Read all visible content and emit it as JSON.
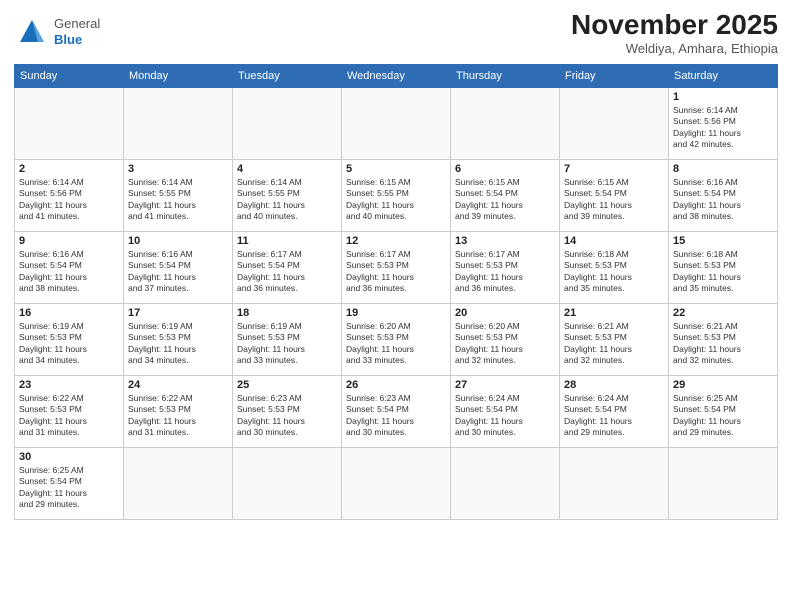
{
  "header": {
    "logo": {
      "general": "General",
      "blue": "Blue"
    },
    "month": "November 2025",
    "location": "Weldiya, Amhara, Ethiopia"
  },
  "weekdays": [
    "Sunday",
    "Monday",
    "Tuesday",
    "Wednesday",
    "Thursday",
    "Friday",
    "Saturday"
  ],
  "weeks": [
    [
      {
        "day": "",
        "info": ""
      },
      {
        "day": "",
        "info": ""
      },
      {
        "day": "",
        "info": ""
      },
      {
        "day": "",
        "info": ""
      },
      {
        "day": "",
        "info": ""
      },
      {
        "day": "",
        "info": ""
      },
      {
        "day": "1",
        "info": "Sunrise: 6:14 AM\nSunset: 5:56 PM\nDaylight: 11 hours\nand 42 minutes."
      }
    ],
    [
      {
        "day": "2",
        "info": "Sunrise: 6:14 AM\nSunset: 5:56 PM\nDaylight: 11 hours\nand 41 minutes."
      },
      {
        "day": "3",
        "info": "Sunrise: 6:14 AM\nSunset: 5:55 PM\nDaylight: 11 hours\nand 41 minutes."
      },
      {
        "day": "4",
        "info": "Sunrise: 6:14 AM\nSunset: 5:55 PM\nDaylight: 11 hours\nand 40 minutes."
      },
      {
        "day": "5",
        "info": "Sunrise: 6:15 AM\nSunset: 5:55 PM\nDaylight: 11 hours\nand 40 minutes."
      },
      {
        "day": "6",
        "info": "Sunrise: 6:15 AM\nSunset: 5:54 PM\nDaylight: 11 hours\nand 39 minutes."
      },
      {
        "day": "7",
        "info": "Sunrise: 6:15 AM\nSunset: 5:54 PM\nDaylight: 11 hours\nand 39 minutes."
      },
      {
        "day": "8",
        "info": "Sunrise: 6:16 AM\nSunset: 5:54 PM\nDaylight: 11 hours\nand 38 minutes."
      }
    ],
    [
      {
        "day": "9",
        "info": "Sunrise: 6:16 AM\nSunset: 5:54 PM\nDaylight: 11 hours\nand 38 minutes."
      },
      {
        "day": "10",
        "info": "Sunrise: 6:16 AM\nSunset: 5:54 PM\nDaylight: 11 hours\nand 37 minutes."
      },
      {
        "day": "11",
        "info": "Sunrise: 6:17 AM\nSunset: 5:54 PM\nDaylight: 11 hours\nand 36 minutes."
      },
      {
        "day": "12",
        "info": "Sunrise: 6:17 AM\nSunset: 5:53 PM\nDaylight: 11 hours\nand 36 minutes."
      },
      {
        "day": "13",
        "info": "Sunrise: 6:17 AM\nSunset: 5:53 PM\nDaylight: 11 hours\nand 36 minutes."
      },
      {
        "day": "14",
        "info": "Sunrise: 6:18 AM\nSunset: 5:53 PM\nDaylight: 11 hours\nand 35 minutes."
      },
      {
        "day": "15",
        "info": "Sunrise: 6:18 AM\nSunset: 5:53 PM\nDaylight: 11 hours\nand 35 minutes."
      }
    ],
    [
      {
        "day": "16",
        "info": "Sunrise: 6:19 AM\nSunset: 5:53 PM\nDaylight: 11 hours\nand 34 minutes."
      },
      {
        "day": "17",
        "info": "Sunrise: 6:19 AM\nSunset: 5:53 PM\nDaylight: 11 hours\nand 34 minutes."
      },
      {
        "day": "18",
        "info": "Sunrise: 6:19 AM\nSunset: 5:53 PM\nDaylight: 11 hours\nand 33 minutes."
      },
      {
        "day": "19",
        "info": "Sunrise: 6:20 AM\nSunset: 5:53 PM\nDaylight: 11 hours\nand 33 minutes."
      },
      {
        "day": "20",
        "info": "Sunrise: 6:20 AM\nSunset: 5:53 PM\nDaylight: 11 hours\nand 32 minutes."
      },
      {
        "day": "21",
        "info": "Sunrise: 6:21 AM\nSunset: 5:53 PM\nDaylight: 11 hours\nand 32 minutes."
      },
      {
        "day": "22",
        "info": "Sunrise: 6:21 AM\nSunset: 5:53 PM\nDaylight: 11 hours\nand 32 minutes."
      }
    ],
    [
      {
        "day": "23",
        "info": "Sunrise: 6:22 AM\nSunset: 5:53 PM\nDaylight: 11 hours\nand 31 minutes."
      },
      {
        "day": "24",
        "info": "Sunrise: 6:22 AM\nSunset: 5:53 PM\nDaylight: 11 hours\nand 31 minutes."
      },
      {
        "day": "25",
        "info": "Sunrise: 6:23 AM\nSunset: 5:53 PM\nDaylight: 11 hours\nand 30 minutes."
      },
      {
        "day": "26",
        "info": "Sunrise: 6:23 AM\nSunset: 5:54 PM\nDaylight: 11 hours\nand 30 minutes."
      },
      {
        "day": "27",
        "info": "Sunrise: 6:24 AM\nSunset: 5:54 PM\nDaylight: 11 hours\nand 30 minutes."
      },
      {
        "day": "28",
        "info": "Sunrise: 6:24 AM\nSunset: 5:54 PM\nDaylight: 11 hours\nand 29 minutes."
      },
      {
        "day": "29",
        "info": "Sunrise: 6:25 AM\nSunset: 5:54 PM\nDaylight: 11 hours\nand 29 minutes."
      }
    ],
    [
      {
        "day": "30",
        "info": "Sunrise: 6:25 AM\nSunset: 5:54 PM\nDaylight: 11 hours\nand 29 minutes."
      },
      {
        "day": "",
        "info": ""
      },
      {
        "day": "",
        "info": ""
      },
      {
        "day": "",
        "info": ""
      },
      {
        "day": "",
        "info": ""
      },
      {
        "day": "",
        "info": ""
      },
      {
        "day": "",
        "info": ""
      }
    ]
  ]
}
